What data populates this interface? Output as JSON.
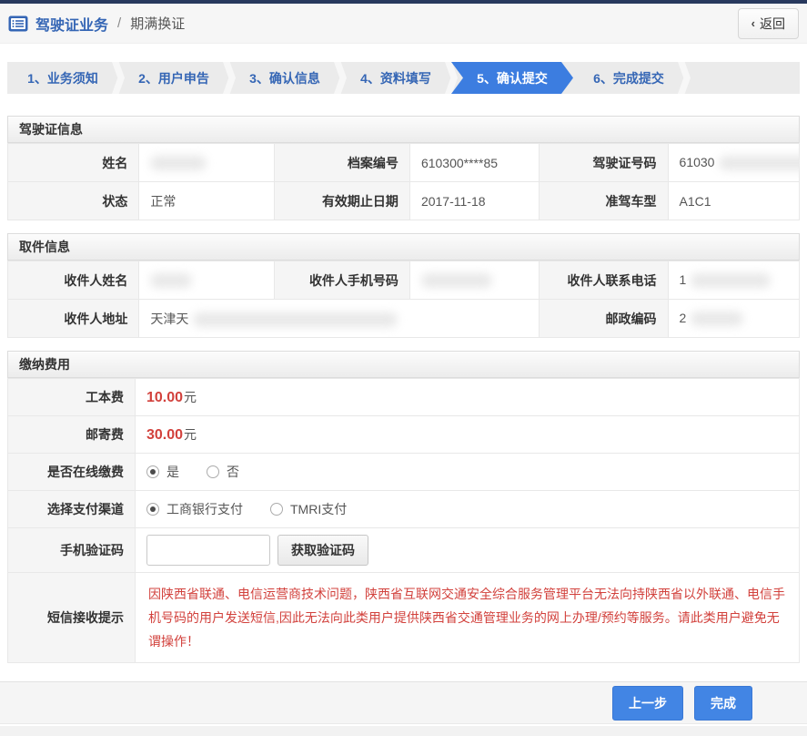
{
  "header": {
    "title": "驾驶证业务",
    "divider": "/",
    "subtitle": "期满换证",
    "back_chevron": "‹",
    "back_button": "返回"
  },
  "steps": {
    "active_index": 4,
    "items": [
      {
        "label": "1、业务须知"
      },
      {
        "label": "2、用户申告"
      },
      {
        "label": "3、确认信息"
      },
      {
        "label": "4、资料填写"
      },
      {
        "label": "5、确认提交"
      },
      {
        "label": "6、完成提交"
      }
    ]
  },
  "license_info": {
    "title": "驾驶证信息",
    "name_label": "姓名",
    "name_value_redacted": true,
    "file_no_label": "档案编号",
    "file_no_value": "610300****85",
    "license_no_label": "驾驶证号码",
    "license_no_prefix": "61030",
    "status_label": "状态",
    "status_value": "正常",
    "expiry_label": "有效期止日期",
    "expiry_value": "2017-11-18",
    "vehicle_class_label": "准驾车型",
    "vehicle_class_value": "A1C1"
  },
  "pickup_info": {
    "title": "取件信息",
    "recipient_name_label": "收件人姓名",
    "recipient_name_redacted": true,
    "recipient_mobile_label": "收件人手机号码",
    "recipient_mobile_redacted": true,
    "recipient_phone_label": "收件人联系电话",
    "recipient_phone_prefix": "1",
    "recipient_address_label": "收件人地址",
    "recipient_address_prefix": "天津天",
    "postcode_label": "邮政编码",
    "postcode_prefix": "2"
  },
  "payment": {
    "title": "缴纳费用",
    "cost_label": "工本费",
    "cost_value": "10.00",
    "cost_unit": "元",
    "postage_label": "邮寄费",
    "postage_value": "30.00",
    "postage_unit": "元",
    "online_pay_label": "是否在线缴费",
    "online_yes": "是",
    "online_no": "否",
    "online_selected": "是",
    "channel_label": "选择支付渠道",
    "channel_icbc": "工商银行支付",
    "channel_tmri": "TMRI支付",
    "channel_selected": "工商银行支付",
    "sms_code_label": "手机验证码",
    "sms_code_value": "",
    "sms_code_button": "获取验证码",
    "sms_notice_label": "短信接收提示",
    "sms_notice_text": "因陕西省联通、电信运营商技术问题，陕西省互联网交通安全综合服务管理平台无法向持陕西省以外联通、电信手机号码的用户发送短信,因此无法向此类用户提供陕西省交通管理业务的网上办理/预约等服务。请此类用户避免无谓操作！"
  },
  "footer": {
    "prev_button": "上一步",
    "finish_button": "完成"
  },
  "colors": {
    "top_bar_navy": "#28395e",
    "title_blue": "#3566b5",
    "step_active_blue": "#3c7de0",
    "button_blue": "#4285e4",
    "alert_red": "#d2413c",
    "label_cell_gray": "#f5f5f5"
  }
}
